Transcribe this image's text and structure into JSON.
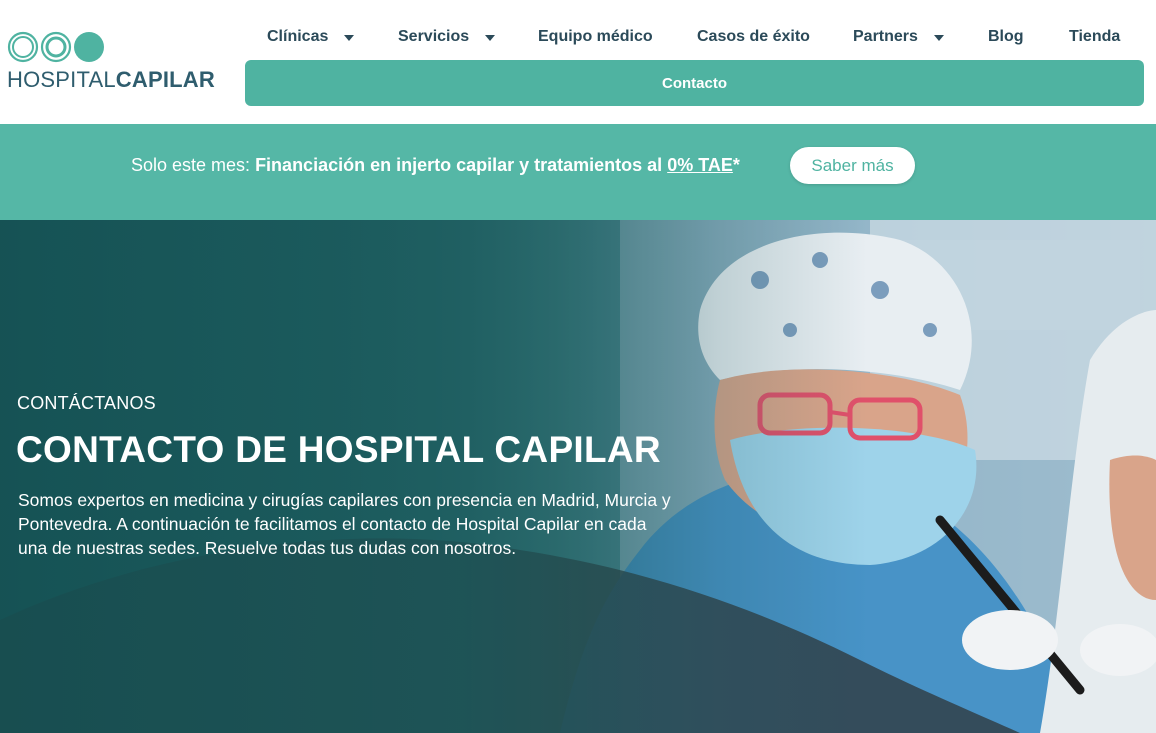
{
  "brand": {
    "logo_thin": "HOSPITAL",
    "logo_bold": "CAPILAR",
    "colors": {
      "accent": "#4fb3a1",
      "navy": "#2b4a59",
      "banner": "#55b7a6"
    }
  },
  "nav": {
    "items": [
      {
        "label": "Clínicas",
        "has_dropdown": true
      },
      {
        "label": "Servicios",
        "has_dropdown": true
      },
      {
        "label": "Equipo médico",
        "has_dropdown": false
      },
      {
        "label": "Casos de éxito",
        "has_dropdown": false
      },
      {
        "label": "Partners",
        "has_dropdown": true
      },
      {
        "label": "Blog",
        "has_dropdown": false
      },
      {
        "label": "Tienda",
        "has_dropdown": false
      }
    ],
    "contact_label": "Contacto"
  },
  "promo": {
    "prefix": "Solo este mes: ",
    "highlight": "Financiación en injerto capilar y tratamientos al ",
    "tae": "0% TAE",
    "asterisk": "*",
    "button_label": "Saber más"
  },
  "hero": {
    "eyebrow": "CONTÁCTANOS",
    "title": "CONTACTO DE HOSPITAL CAPILAR",
    "description": "Somos expertos en medicina y cirugías capilares con presencia en Madrid, Murcia y Pontevedra. A continuación te facilitamos el contacto de Hospital Capilar en cada una de nuestras sedes. Resuelve todas tus dudas con nosotros."
  }
}
